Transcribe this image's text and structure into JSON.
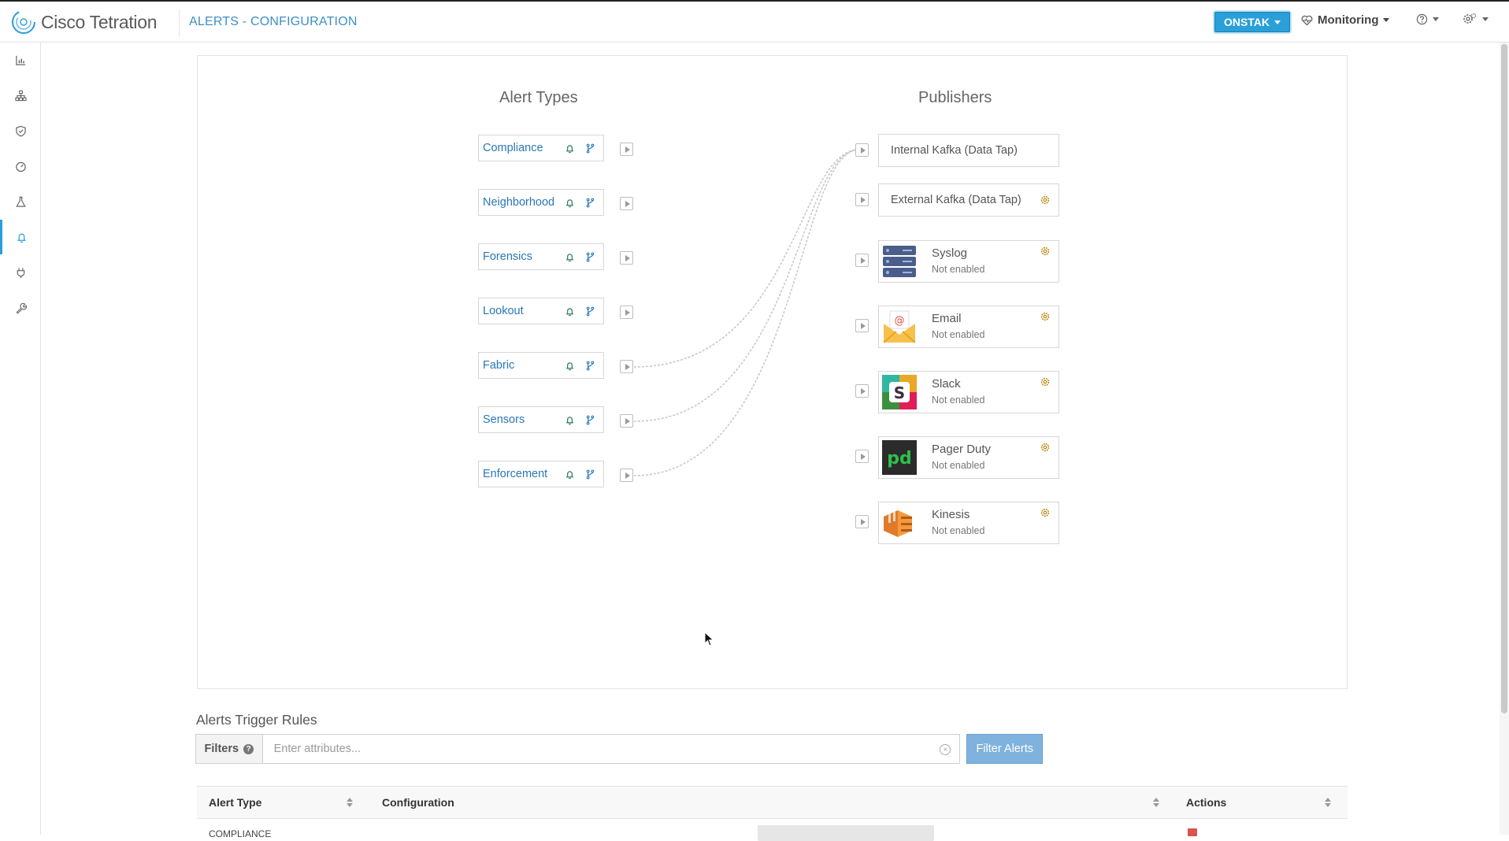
{
  "app": {
    "brand": "Cisco Tetration",
    "page_title": "ALERTS - CONFIGURATION"
  },
  "header": {
    "scope_label": "ONSTAK",
    "monitoring_label": "Monitoring",
    "help_icon": "question-circle-icon",
    "settings_icon": "gear-menu-icon"
  },
  "sidebar": {
    "items": [
      {
        "icon": "dashboard-chart-icon"
      },
      {
        "icon": "topology-icon"
      },
      {
        "icon": "shield-icon"
      },
      {
        "icon": "speedometer-icon"
      },
      {
        "icon": "lab-flask-icon"
      },
      {
        "icon": "bell-icon",
        "active": true
      },
      {
        "icon": "plug-icon"
      },
      {
        "icon": "wrench-icon"
      }
    ]
  },
  "config": {
    "alert_types_title": "Alert Types",
    "publishers_title": "Publishers",
    "alert_types": [
      {
        "name": "Compliance"
      },
      {
        "name": "Neighborhood"
      },
      {
        "name": "Forensics"
      },
      {
        "name": "Lookout"
      },
      {
        "name": "Fabric"
      },
      {
        "name": "Sensors"
      },
      {
        "name": "Enforcement"
      }
    ],
    "publishers": [
      {
        "name": "Internal Kafka (Data Tap)"
      },
      {
        "name": "External Kafka (Data Tap)"
      },
      {
        "name": "Syslog",
        "status": "Not enabled",
        "icon": "syslog-server-icon"
      },
      {
        "name": "Email",
        "status": "Not enabled",
        "icon": "email-envelope-icon"
      },
      {
        "name": "Slack",
        "status": "Not enabled",
        "icon": "slack-logo-icon"
      },
      {
        "name": "Pager Duty",
        "status": "Not enabled",
        "icon": "pagerduty-logo-icon"
      },
      {
        "name": "Kinesis",
        "status": "Not enabled",
        "icon": "kinesis-logo-icon"
      }
    ],
    "connections": [
      {
        "from": "Fabric",
        "to": "Internal Kafka (Data Tap)"
      },
      {
        "from": "Sensors",
        "to": "Internal Kafka (Data Tap)"
      },
      {
        "from": "Enforcement",
        "to": "Internal Kafka (Data Tap)"
      }
    ]
  },
  "trigger_rules": {
    "title": "Alerts Trigger Rules",
    "filters_label": "Filters",
    "filter_placeholder": "Enter attributes...",
    "filter_button": "Filter Alerts",
    "columns": [
      "Alert Type",
      "Configuration",
      "Actions"
    ],
    "first_row": {
      "alert_type": "COMPLIANCE"
    }
  },
  "colors": {
    "accent": "#2a9fd8",
    "link": "#2a77b8",
    "connector": "#c8c8c8"
  }
}
